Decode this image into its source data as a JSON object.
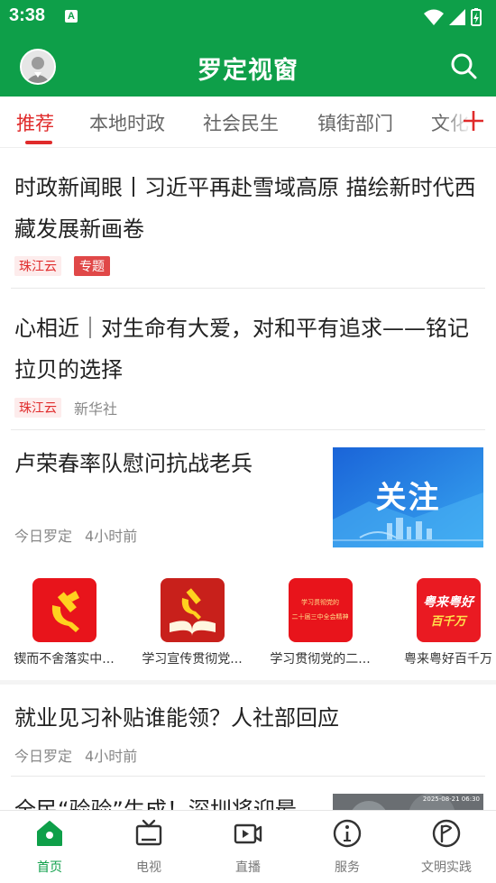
{
  "status_bar": {
    "time": "3:38",
    "notification_letter": "A"
  },
  "header": {
    "title": "罗定视窗"
  },
  "tabs": [
    {
      "label": "推荐"
    },
    {
      "label": "本地时政"
    },
    {
      "label": "社会民生"
    },
    {
      "label": "镇街部门"
    },
    {
      "label": "文化"
    }
  ],
  "articles": [
    {
      "title": "时政新闻眼丨习近平再赴雪域高原 描绘新时代西藏发展新画卷",
      "source": "珠江云",
      "badge": "专题"
    },
    {
      "title": "心相近｜对生命有大爱，对和平有追求——铭记拉贝的选择",
      "source": "珠江云",
      "author": "新华社"
    },
    {
      "title": "卢荣春率队慰问抗战老兵",
      "source": "今日罗定",
      "time": "4小时前",
      "thumb_text": "关注"
    },
    {
      "title": "就业见习补贴谁能领？人社部回应",
      "source": "今日罗定",
      "time": "4小时前"
    },
    {
      "title": "全民“验验”生成！深圳将迎最",
      "thumb_text": "2025-08-21 06:30"
    }
  ],
  "shortcuts": [
    {
      "label": "锲而不舍落实中..."
    },
    {
      "label": "学习宣传贯彻党..."
    },
    {
      "label": "学习贯彻党的二...",
      "icon_text_1": "学习贯彻党的",
      "icon_text_2": "二十届三中全会精神"
    },
    {
      "label": "粤来粤好百千万",
      "icon_text_1": "粤来粤好",
      "icon_text_2": "百千万"
    }
  ],
  "bottom_nav": [
    {
      "label": "首页",
      "icon": "home-icon"
    },
    {
      "label": "电视",
      "icon": "tv-icon"
    },
    {
      "label": "直播",
      "icon": "live-video-icon"
    },
    {
      "label": "服务",
      "icon": "info-icon"
    },
    {
      "label": "文明实践",
      "icon": "flag-circle-icon"
    }
  ],
  "colors": {
    "brand_green": "#0e9f49",
    "accent_red": "#e02b2b"
  }
}
